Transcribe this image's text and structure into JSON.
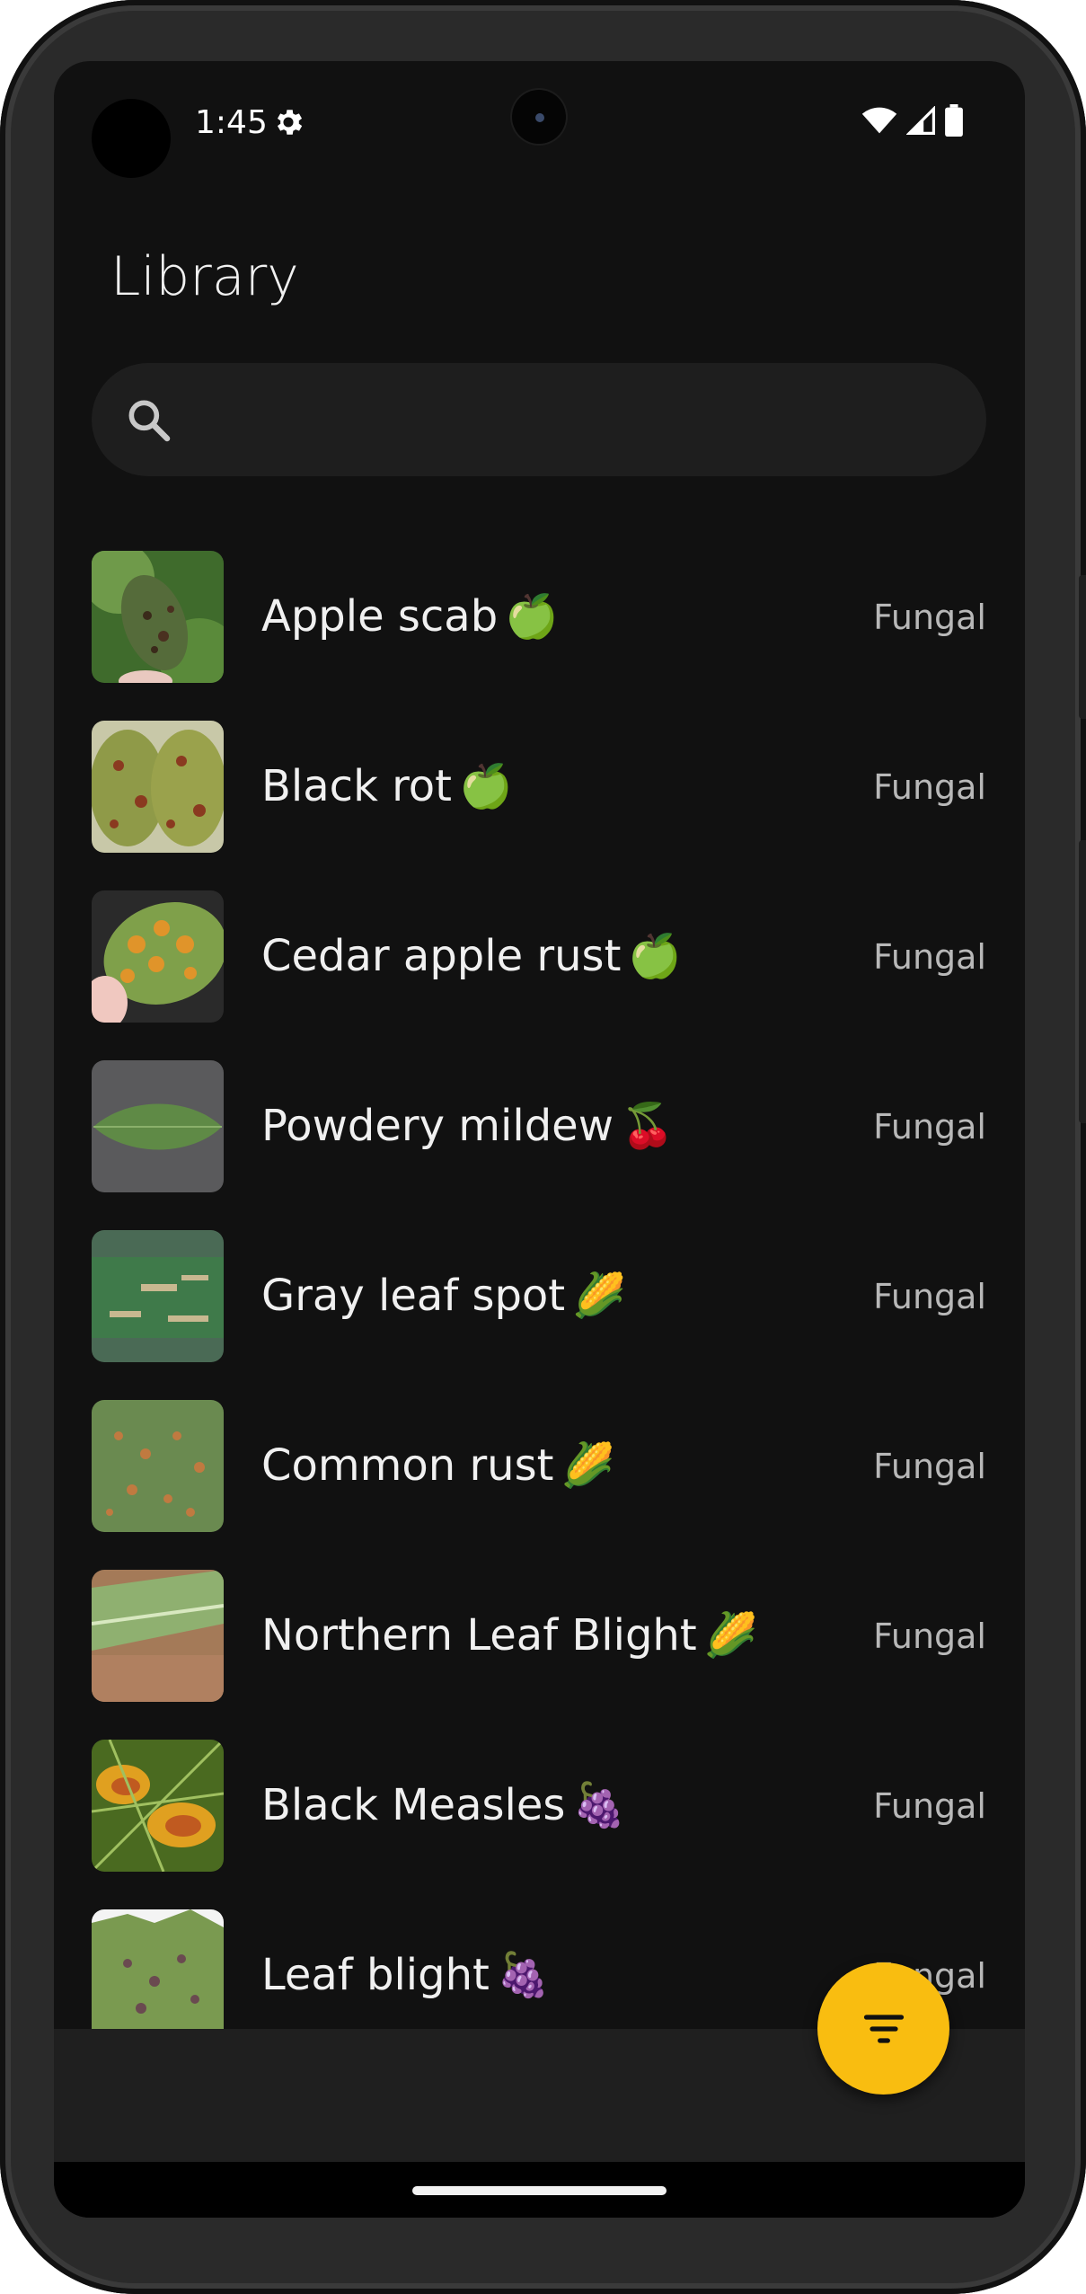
{
  "status_bar": {
    "time": "1:45",
    "icons": [
      "settings-icon",
      "wifi-icon",
      "signal-icon",
      "battery-icon"
    ]
  },
  "app": {
    "title": "Library"
  },
  "search": {
    "placeholder": "",
    "value": ""
  },
  "diseases": [
    {
      "name": "Apple scab",
      "emoji": "🍏",
      "type": "Fungal"
    },
    {
      "name": "Black rot",
      "emoji": "🍏",
      "type": "Fungal"
    },
    {
      "name": "Cedar apple rust",
      "emoji": "🍏",
      "type": "Fungal"
    },
    {
      "name": "Powdery mildew",
      "emoji": "🍒",
      "type": "Fungal"
    },
    {
      "name": "Gray leaf spot",
      "emoji": "🌽",
      "type": "Fungal"
    },
    {
      "name": "Common rust",
      "emoji": "🌽",
      "type": "Fungal"
    },
    {
      "name": "Northern Leaf Blight",
      "emoji": "🌽",
      "type": "Fungal"
    },
    {
      "name": "Black Measles",
      "emoji": "🍇",
      "type": "Fungal"
    },
    {
      "name": "Leaf blight",
      "emoji": "🍇",
      "type": "Fungal"
    }
  ],
  "fab": {
    "icon": "filter-icon"
  },
  "colors": {
    "background": "#111111",
    "search_bg": "#1e1e1e",
    "fab": "#f9bd10",
    "secondary_text": "#b8b8b8"
  }
}
